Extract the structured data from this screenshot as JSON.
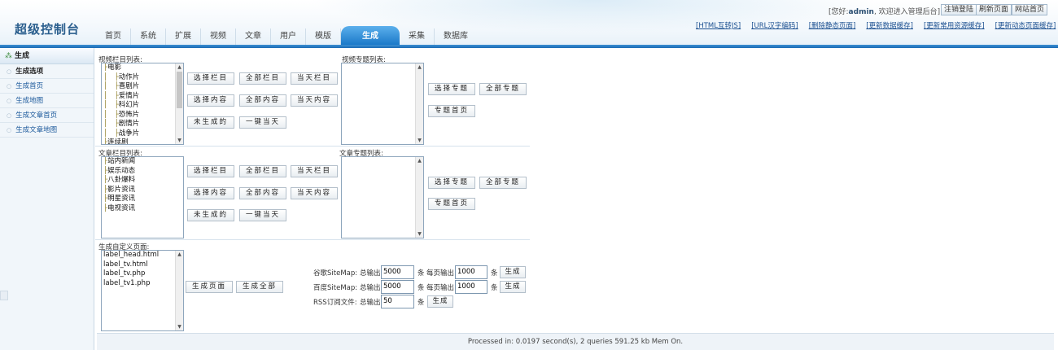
{
  "header": {
    "logo": "超级控制台",
    "nav": [
      "首页",
      "系统",
      "扩展",
      "视频",
      "文章",
      "用户",
      "模版",
      "生成",
      "采集",
      "数据库"
    ],
    "active_nav": "生成",
    "welcome_prefix": "[您好:",
    "user": "admin",
    "welcome_suffix": ", 欢迎进入管理后台]",
    "logout_label": "注销登陆",
    "refresh_label": "刷新页面",
    "site_home_label": "网站首页",
    "quick_links": [
      "[HTML互转JS]",
      "[URL汉字编码]",
      "[删除静态页面]",
      "[更新数据缓存]",
      "[更新常用资源缓存]",
      "[更新动态页面缓存]"
    ]
  },
  "sidebar": {
    "title": "生成",
    "items": [
      "生成选项",
      "生成首页",
      "生成地图",
      "生成文章首页",
      "生成文章地图"
    ]
  },
  "video": {
    "category_label": "视频栏目列表:",
    "categories": [
      {
        "prefix": "├",
        "name": "电影"
      },
      {
        "prefix": "│　├",
        "name": "动作片"
      },
      {
        "prefix": "│　├",
        "name": "喜剧片"
      },
      {
        "prefix": "│　├",
        "name": "爱情片"
      },
      {
        "prefix": "│　├",
        "name": "科幻片"
      },
      {
        "prefix": "│　├",
        "name": "恐怖片"
      },
      {
        "prefix": "│　├",
        "name": "剧情片"
      },
      {
        "prefix": "│　├",
        "name": "战争片"
      },
      {
        "prefix": "├",
        "name": "连续剧"
      }
    ],
    "topic_label": "视频专题列表:"
  },
  "article": {
    "category_label": "文章栏目列表:",
    "categories": [
      {
        "prefix": "├",
        "name": "站内新闻"
      },
      {
        "prefix": "├",
        "name": "娱乐动态"
      },
      {
        "prefix": "├",
        "name": "八卦爆料"
      },
      {
        "prefix": "├",
        "name": "影片资讯"
      },
      {
        "prefix": "├",
        "name": "明星资讯"
      },
      {
        "prefix": "├",
        "name": "电视资讯"
      }
    ],
    "topic_label": "文章专题列表:"
  },
  "buttons": {
    "select_category": "选择栏目",
    "all_categories": "全部栏目",
    "today_category": "当天栏目",
    "select_content": "选择内容",
    "all_content": "全部内容",
    "today_content": "当天内容",
    "not_generated": "未生成的",
    "one_click_today": "一键当天",
    "select_topic": "选择专题",
    "all_topics": "全部专题",
    "topic_home": "专题首页",
    "gen_page": "生成页面",
    "gen_all": "生成全部",
    "generate": "生成"
  },
  "custom": {
    "label": "生成自定义页面:",
    "pages": [
      "label_head.html",
      "label_tv.html",
      "label_tv.php",
      "label_tv1.php"
    ]
  },
  "sitemaps": {
    "total_label": "总输出",
    "unit": "条",
    "per_page_label": "每页输出",
    "google": {
      "label": "谷歌SiteMap:",
      "total": "5000",
      "per_page": "1000"
    },
    "baidu": {
      "label": "百度SiteMap:",
      "total": "5000",
      "per_page": "1000"
    },
    "rss": {
      "label": "RSS订阅文件:",
      "total": "50"
    }
  },
  "footer": "Processed in: 0.0197 second(s), 2 queries 591.25 kb Mem On."
}
